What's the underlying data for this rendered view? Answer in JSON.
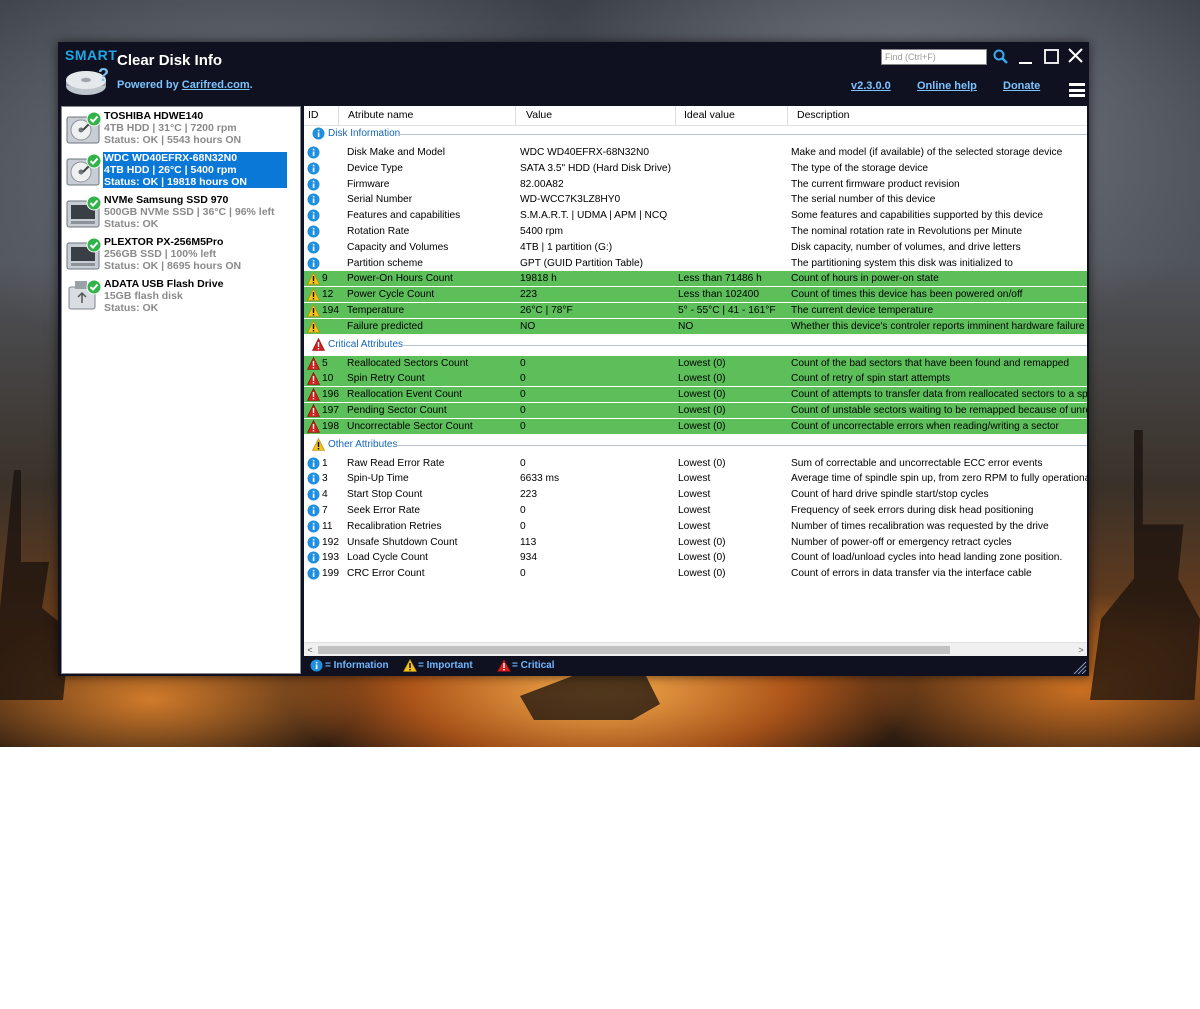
{
  "app": {
    "logo_text": "SMART",
    "title": "Clear Disk Info",
    "powered_prefix": "Powered by ",
    "powered_link": "Carifred.com",
    "powered_suffix": ".",
    "find_placeholder": "Find (Ctrl+F)",
    "version_link": "v2.3.0.0",
    "help_link": "Online help",
    "donate_link": "Donate"
  },
  "disks": [
    {
      "name": "TOSHIBA HDWE140",
      "line2": "4TB HDD | 31°C | 7200 rpm",
      "line3": "Status: OK | 5543 hours ON",
      "icon": "hdd-ok-icon"
    },
    {
      "name": "WDC WD40EFRX-68N32N0",
      "line2": "4TB HDD | 26°C | 5400 rpm",
      "line3": "Status: OK | 19818 hours ON",
      "icon": "hdd-ok-icon",
      "selected": true
    },
    {
      "name": "NVMe Samsung SSD 970",
      "line2": "500GB NVMe SSD | 36°C | 96% left",
      "line3": "Status: OK",
      "icon": "ssd-ok-icon"
    },
    {
      "name": "PLEXTOR PX-256M5Pro",
      "line2": "256GB SSD | 100% left",
      "line3": "Status: OK | 8695 hours ON",
      "icon": "ssd-ok-icon"
    },
    {
      "name": "ADATA USB Flash Drive",
      "line2": "15GB flash disk",
      "line3": "Status: OK",
      "icon": "usb-ok-icon"
    }
  ],
  "columns": [
    "ID",
    "Atribute name",
    "Value",
    "Ideal value",
    "Description"
  ],
  "groups": {
    "info": "Disk Information",
    "critical": "Critical Attributes",
    "other": "Other Attributes"
  },
  "info_rows": [
    {
      "id": "",
      "name": "Disk Make and Model",
      "value": "WDC WD40EFRX-68N32N0",
      "ideal": "",
      "desc": "Make and model (if available) of the selected storage device"
    },
    {
      "id": "",
      "name": "Device Type",
      "value": "SATA  3.5\" HDD (Hard Disk Drive)",
      "ideal": "",
      "desc": "The type of the storage device"
    },
    {
      "id": "",
      "name": "Firmware",
      "value": "82.00A82",
      "ideal": "",
      "desc": "The current firmware product revision"
    },
    {
      "id": "",
      "name": "Serial Number",
      "value": "WD-WCC7K3LZ8HY0",
      "ideal": "",
      "desc": "The serial number of this device"
    },
    {
      "id": "",
      "name": "Features and capabilities",
      "value": "S.M.A.R.T. | UDMA | APM | NCQ",
      "ideal": "",
      "desc": "Some features and capabilities supported by this device"
    },
    {
      "id": "",
      "name": "Rotation Rate",
      "value": "5400 rpm",
      "ideal": "",
      "desc": "The nominal rotation rate in Revolutions per Minute"
    },
    {
      "id": "",
      "name": "Capacity and Volumes",
      "value": "4TB | 1 partition (G:)",
      "ideal": "",
      "desc": "Disk capacity, number of volumes, and drive letters"
    },
    {
      "id": "",
      "name": "Partition scheme",
      "value": "GPT (GUID Partition Table)",
      "ideal": "",
      "desc": "The partitioning system this disk was initialized to"
    }
  ],
  "important_rows": [
    {
      "id": "9",
      "name": "Power-On Hours Count",
      "value": "19818 h",
      "ideal": "Less than 71486 h",
      "desc": "Count of hours in power-on state"
    },
    {
      "id": "12",
      "name": "Power Cycle Count",
      "value": "223",
      "ideal": "Less than 102400",
      "desc": "Count of times this device has been powered on/off"
    },
    {
      "id": "194",
      "name": "Temperature",
      "value": "26°C | 78°F",
      "ideal": "5° - 55°C | 41 - 161°F",
      "desc": "The current device temperature"
    },
    {
      "id": "",
      "name": "Failure predicted",
      "value": "NO",
      "ideal": "NO",
      "desc": "Whether this device's controler reports imminent hardware failure"
    }
  ],
  "critical_rows": [
    {
      "id": "5",
      "name": "Reallocated Sectors Count",
      "value": "0",
      "ideal": "Lowest (0)",
      "desc": "Count of the bad sectors that have been found and remapped"
    },
    {
      "id": "10",
      "name": "Spin Retry Count",
      "value": "0",
      "ideal": "Lowest (0)",
      "desc": "Count of retry of spin start attempts"
    },
    {
      "id": "196",
      "name": "Reallocation Event Count",
      "value": "0",
      "ideal": "Lowest (0)",
      "desc": "Count of attempts to transfer data from reallocated sectors to a spar"
    },
    {
      "id": "197",
      "name": "Pending Sector Count",
      "value": "0",
      "ideal": "Lowest (0)",
      "desc": "Count of unstable sectors waiting to be remapped because of unreco"
    },
    {
      "id": "198",
      "name": "Uncorrectable Sector Count",
      "value": "0",
      "ideal": "Lowest (0)",
      "desc": "Count of uncorrectable errors when reading/writing a sector"
    }
  ],
  "other_rows": [
    {
      "id": "1",
      "name": "Raw Read Error Rate",
      "value": "0",
      "ideal": "Lowest (0)",
      "desc": "Sum of correctable and uncorrectable ECC error events"
    },
    {
      "id": "3",
      "name": "Spin-Up Time",
      "value": "6633 ms",
      "ideal": "Lowest",
      "desc": "Average time of spindle spin up, from zero RPM to fully operational, i"
    },
    {
      "id": "4",
      "name": "Start Stop Count",
      "value": "223",
      "ideal": "Lowest",
      "desc": "Count of hard drive spindle start/stop cycles"
    },
    {
      "id": "7",
      "name": "Seek Error Rate",
      "value": "0",
      "ideal": "Lowest",
      "desc": "Frequency of seek errors during disk head positioning"
    },
    {
      "id": "11",
      "name": "Recalibration Retries",
      "value": "0",
      "ideal": "Lowest",
      "desc": "Number of times recalibration was requested by the drive"
    },
    {
      "id": "192",
      "name": "Unsafe Shutdown Count",
      "value": "113",
      "ideal": "Lowest (0)",
      "desc": "Number of power-off or emergency retract cycles"
    },
    {
      "id": "193",
      "name": "Load Cycle Count",
      "value": "934",
      "ideal": "Lowest (0)",
      "desc": "Count of load/unload cycles into head landing zone position."
    },
    {
      "id": "199",
      "name": "CRC Error Count",
      "value": "0",
      "ideal": "Lowest (0)",
      "desc": "Count of errors in data transfer via the interface cable"
    }
  ],
  "legend": {
    "info": "= Information",
    "important": "= Important",
    "critical": "= Critical"
  },
  "colors": {
    "accent": "#1fa7e8",
    "link": "#7cc3ff",
    "selected": "#0a78d7",
    "row_highlight": "#5cbf5a",
    "window_bg": "#0f1020"
  }
}
